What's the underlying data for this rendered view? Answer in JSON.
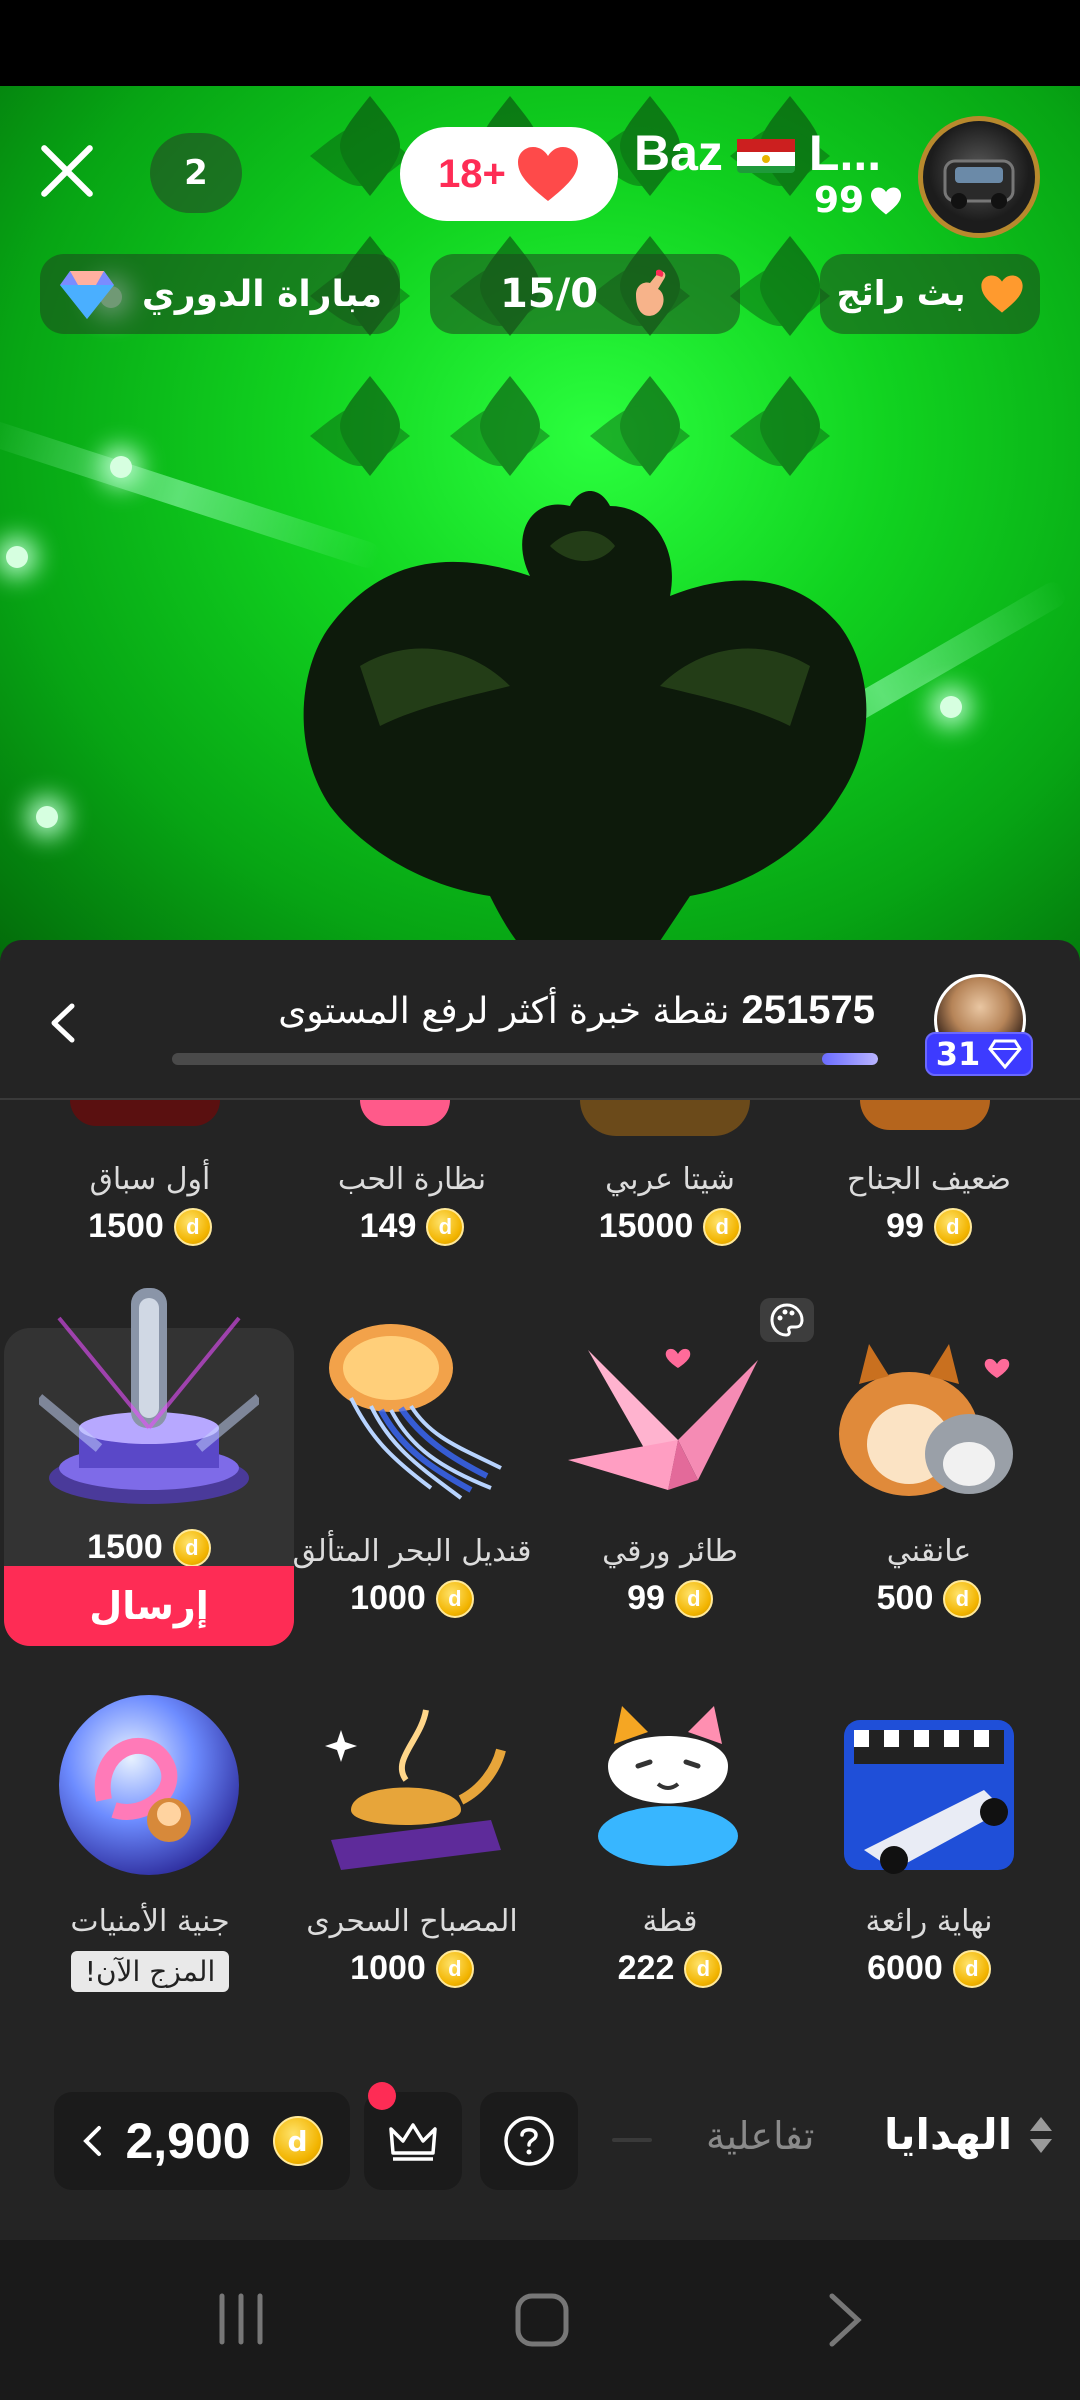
{
  "live": {
    "viewer_count": "2",
    "follow_label": "18+",
    "host_name": "Baz",
    "host_name_suffix": "L...",
    "host_likes": "99",
    "league_label": "مباراة الدوري",
    "score": "15/0",
    "trending_label": "بث رائج"
  },
  "sheet": {
    "xp_points": "251575",
    "xp_text": "نقطة خبرة أكثر لرفع المستوى",
    "xp_progress": 0.08,
    "level": "31"
  },
  "gifts_row1": [
    {
      "name": "أول سباق",
      "price": "1500"
    },
    {
      "name": "نظارة الحب",
      "price": "149"
    },
    {
      "name": "شيتا عربي",
      "price": "15000"
    },
    {
      "name": "ضعيف الجناح",
      "price": "99"
    }
  ],
  "gifts_row2": [
    {
      "name": "",
      "price": "1500"
    },
    {
      "name": "قنديل البحر المتألق",
      "price": "1000"
    },
    {
      "name": "طائر ورقي",
      "price": "99"
    },
    {
      "name": "عانقني",
      "price": "500"
    }
  ],
  "gifts_row3": [
    {
      "name": "جنية الأمنيات",
      "tag": "المزج الآن!"
    },
    {
      "name": "المصباح السحرى",
      "price": "1000"
    },
    {
      "name": "قطة",
      "price": "222"
    },
    {
      "name": "نهاية رائعة",
      "price": "6000"
    }
  ],
  "send_label": "إرسال",
  "toolbar": {
    "balance": "2,900",
    "tab_interactive": "تفاعلية",
    "tab_gifts": "الهدايا"
  },
  "colors": {
    "accent": "#fe2c55",
    "coin": "#f2b400",
    "level": "#3d3bff",
    "sheet_bg": "#242424"
  },
  "icons": [
    "close-icon",
    "heart-icon",
    "flag-icon",
    "diamond-icon",
    "coin-icon",
    "chevron-left-icon",
    "palette-icon",
    "crown-icon",
    "question-coin-icon",
    "sort-icon",
    "nav-recents-icon",
    "nav-home-icon",
    "nav-back-icon"
  ]
}
